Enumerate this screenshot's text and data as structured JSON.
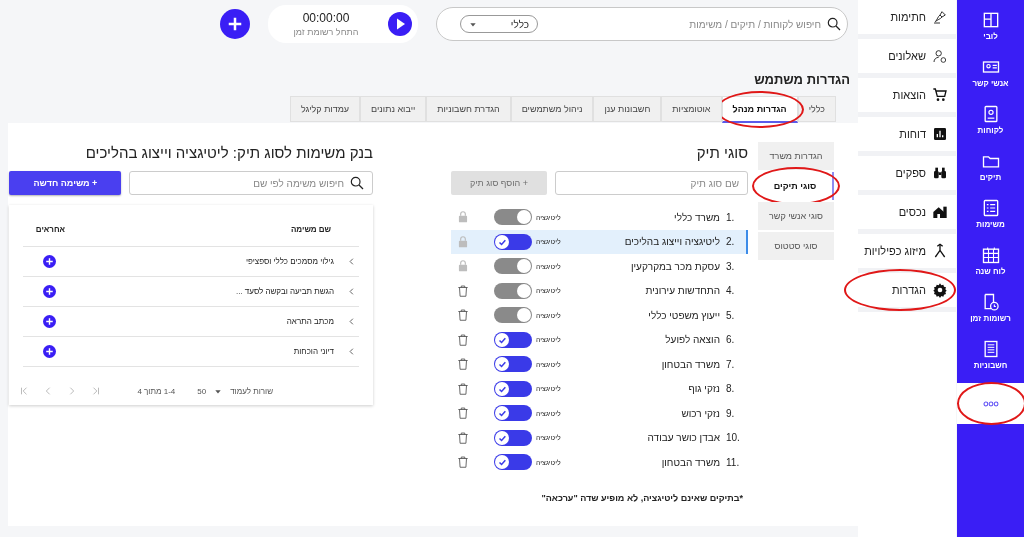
{
  "rail": {
    "items": [
      {
        "label": "לובי"
      },
      {
        "label": "אנשי קשר"
      },
      {
        "label": "לקוחות"
      },
      {
        "label": "תיקים"
      },
      {
        "label": "משימות"
      },
      {
        "label": "לוח שנה"
      },
      {
        "label": "רשומות זמן"
      },
      {
        "label": "חשבוניות"
      }
    ],
    "more": {
      "circled": true
    }
  },
  "sidebar": {
    "items": [
      {
        "label": "חתימות",
        "circled": false
      },
      {
        "label": "שאלונים",
        "circled": false
      },
      {
        "label": "הוצאות",
        "circled": false
      },
      {
        "label": "דוחות",
        "circled": false
      },
      {
        "label": "ספקים",
        "circled": false
      },
      {
        "label": "נכסים",
        "circled": false
      },
      {
        "label": "מיזוג כפילויות",
        "circled": false
      },
      {
        "label": "הגדרות",
        "circled": true
      }
    ]
  },
  "topbar": {
    "search": {
      "placeholder": "חיפוש לקוחות / תיקים / משימות",
      "scope": "כללי"
    },
    "timer": {
      "time": "00:00:00",
      "caption": "התחל רשומת זמן"
    }
  },
  "page_title": "הגדרות משתמש",
  "tabs": [
    {
      "label": "כללי",
      "selected": false,
      "circled": false
    },
    {
      "label": "הגדרות מנהל",
      "selected": true,
      "circled": true
    },
    {
      "label": "אוטומציות",
      "selected": false,
      "circled": false
    },
    {
      "label": "חשבונות ענן",
      "selected": false,
      "circled": false
    },
    {
      "label": "ניהול משתמשים",
      "selected": false,
      "circled": false
    },
    {
      "label": "הגדרת חשבוניות",
      "selected": false,
      "circled": false
    },
    {
      "label": "ייבוא נתונים",
      "selected": false,
      "circled": false
    },
    {
      "label": "עמדות קליגל",
      "selected": false,
      "circled": false
    }
  ],
  "subnav": [
    {
      "label": "הגדרות משרד",
      "selected": false,
      "circled": false
    },
    {
      "label": "סוגי תיקים",
      "selected": true,
      "circled": true
    },
    {
      "label": "סוגי אנשי קשר",
      "selected": false,
      "circled": false
    },
    {
      "label": "סוגי סטטוס",
      "selected": false,
      "circled": false
    }
  ],
  "case_types": {
    "title": "סוגי תיק",
    "input_placeholder": "שם סוג תיק",
    "add_button": {
      "label": "+ הוסף סוג תיק",
      "disabled": true
    },
    "rows": [
      {
        "number": "1.",
        "name": "משרד כללי",
        "toggle_label": "ליטיגציה",
        "on": false,
        "locked": true,
        "selected": false
      },
      {
        "number": "2.",
        "name": "ליטיגציה וייצוג בהליכים",
        "toggle_label": "ליטיגציה",
        "on": true,
        "locked": true,
        "selected": true
      },
      {
        "number": "3.",
        "name": "עסקת מכר במקרקעין",
        "toggle_label": "ליטיגציה",
        "on": false,
        "locked": true,
        "selected": false
      },
      {
        "number": "4.",
        "name": "התחדשות עירונית",
        "toggle_label": "ליטיגציה",
        "on": false,
        "locked": false,
        "selected": false
      },
      {
        "number": "5.",
        "name": "ייעוץ משפטי כללי",
        "toggle_label": "ליטיגציה",
        "on": false,
        "locked": false,
        "selected": false
      },
      {
        "number": "6.",
        "name": "הוצאה לפועל",
        "toggle_label": "ליטיגציה",
        "on": true,
        "locked": false,
        "selected": false
      },
      {
        "number": "7.",
        "name": "משרד הבטחון",
        "toggle_label": "ליטיגציה",
        "on": true,
        "locked": false,
        "selected": false
      },
      {
        "number": "8.",
        "name": "נזקי גוף",
        "toggle_label": "ליטיגציה",
        "on": true,
        "locked": false,
        "selected": false
      },
      {
        "number": "9.",
        "name": "נזקי רכוש",
        "toggle_label": "ליטיגציה",
        "on": true,
        "locked": false,
        "selected": false
      },
      {
        "number": "10.",
        "name": "אבדן כושר עבודה",
        "toggle_label": "ליטיגציה",
        "on": true,
        "locked": false,
        "selected": false
      },
      {
        "number": "11.",
        "name": "משרד הבטחון",
        "toggle_label": "ליטיגציה",
        "on": true,
        "locked": false,
        "selected": false
      }
    ],
    "footnote": "*בתיקים שאינם ליטיגציה, לא מופיע שדה \"ערכאה\""
  },
  "task_bank": {
    "title": "בנק משימות לסוג תיק: ליטיגציה וייצוג בהליכים",
    "search_placeholder": "חיפוש משימה לפי שם",
    "new_button": "+ משימה חדשה",
    "columns": [
      "שם משימה",
      "אחראים"
    ],
    "rows": [
      {
        "name": "גילוי מסמכים כללי וספציפי"
      },
      {
        "name": "הגשת תביעה ובקשה לסעד ..."
      },
      {
        "name": "מכתב התראה"
      },
      {
        "name": "דיוני הוכחות"
      }
    ],
    "pagination": {
      "rows_label": "שורות לעמוד",
      "page_size": "50",
      "range": "1-4 מתוך 4"
    }
  }
}
